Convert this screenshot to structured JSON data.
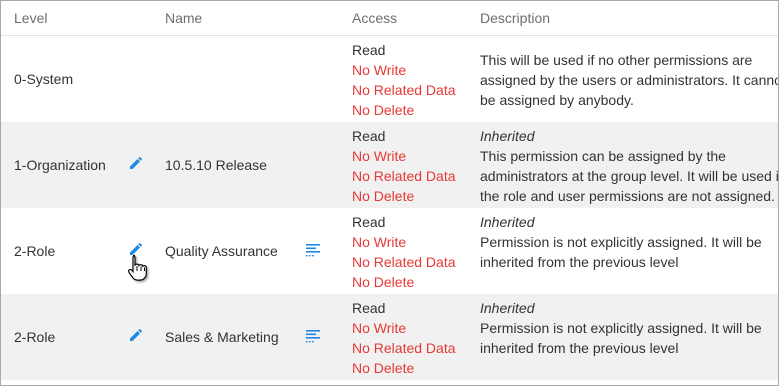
{
  "headers": {
    "level": "Level",
    "name": "Name",
    "access": "Access",
    "description": "Description"
  },
  "rows": [
    {
      "level": "0-System",
      "name": "",
      "access": [
        "Read",
        "No Write",
        "No Related Data",
        "No Delete"
      ],
      "inherited_label": "",
      "description_lines": [
        "This will be used if no other permissions are",
        "assigned by the users or administrators. It cannot",
        "be assigned by anybody."
      ]
    },
    {
      "level": "1-Organization",
      "name": "10.5.10 Release",
      "access": [
        "Read",
        "No Write",
        "No Related Data",
        "No Delete"
      ],
      "inherited_label": "Inherited",
      "description_lines": [
        "This permission can be assigned by the",
        "administrators at the group level. It will be used if",
        "the role and user permissions are not assigned."
      ]
    },
    {
      "level": "2-Role",
      "name": "Quality Assurance",
      "access": [
        "Read",
        "No Write",
        "No Related Data",
        "No Delete"
      ],
      "inherited_label": "Inherited",
      "description_lines": [
        "Permission is not explicitly assigned. It will be",
        "inherited from the previous level"
      ]
    },
    {
      "level": "2-Role",
      "name": "Sales & Marketing",
      "access": [
        "Read",
        "No Write",
        "No Related Data",
        "No Delete"
      ],
      "inherited_label": "Inherited",
      "description_lines": [
        "Permission is not explicitly assigned. It will be",
        "inherited from the previous level"
      ]
    }
  ],
  "colors": {
    "negative_access": "#e53935",
    "icon_blue": "#1e88e5",
    "alt_row": "#f1f1f1",
    "header_text": "#6f6f6f"
  },
  "icons": {
    "edit": "pencil-icon",
    "list": "list-details-icon",
    "cursor": "hand-pointer-icon"
  }
}
